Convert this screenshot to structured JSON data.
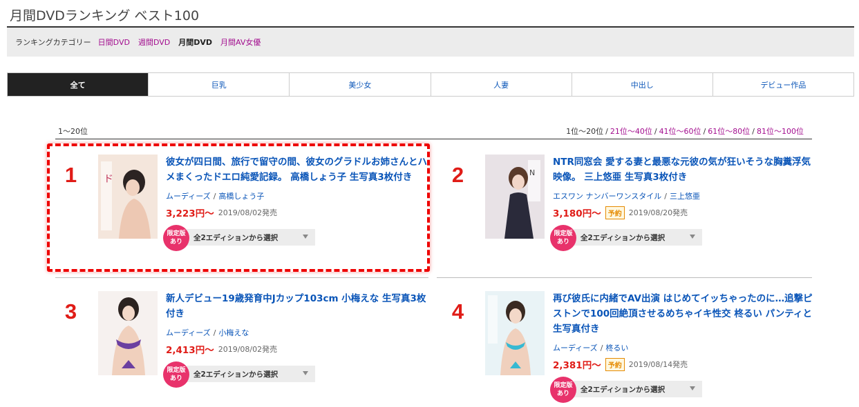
{
  "page": {
    "title": "月間DVDランキング ベスト100"
  },
  "category_bar": {
    "label": "ランキングカテゴリー",
    "links": [
      {
        "label": "日間DVD",
        "current": false
      },
      {
        "label": "週間DVD",
        "current": false
      },
      {
        "label": "月間DVD",
        "current": true
      },
      {
        "label": "月間AV女優",
        "current": false
      }
    ]
  },
  "tabs": [
    {
      "label": "全て",
      "active": true
    },
    {
      "label": "巨乳",
      "active": false
    },
    {
      "label": "美少女",
      "active": false
    },
    {
      "label": "人妻",
      "active": false
    },
    {
      "label": "中出し",
      "active": false
    },
    {
      "label": "デビュー作品",
      "active": false
    }
  ],
  "range": {
    "label": "1〜20位",
    "pager": [
      {
        "label": "1位〜20位",
        "link": false
      },
      {
        "label": "21位〜40位",
        "link": true
      },
      {
        "label": "41位〜60位",
        "link": true
      },
      {
        "label": "61位〜80位",
        "link": true
      },
      {
        "label": "81位〜100位",
        "link": true
      }
    ]
  },
  "items": [
    {
      "rank": "1",
      "title": "彼女が四日間、旅行で留守の間、彼女のグラドルお姉さんとハメまくったドエロ純愛記録。 高橋しょう子 生写真3枚付き",
      "maker": "ムーディーズ",
      "actress": "高橋しょう子",
      "price": "3,223円〜",
      "reserve": "",
      "release": "2019/08/02発売",
      "badge_line1": "限定版",
      "badge_line2": "あり",
      "edition": "全2エディションから選択"
    },
    {
      "rank": "2",
      "title": "NTR同窓会 愛する妻と最悪な元彼の気が狂いそうな胸糞浮気映像。 三上悠亜 生写真3枚付き",
      "maker": "エスワン ナンバーワンスタイル",
      "actress": "三上悠亜",
      "price": "3,180円〜",
      "reserve": "予約",
      "release": "2019/08/20発売",
      "badge_line1": "限定版",
      "badge_line2": "あり",
      "edition": "全2エディションから選択"
    },
    {
      "rank": "3",
      "title": "新人デビュー19歳発育中Jカップ103cm 小梅えな 生写真3枚付き",
      "maker": "ムーディーズ",
      "actress": "小梅えな",
      "price": "2,413円〜",
      "reserve": "",
      "release": "2019/08/02発売",
      "badge_line1": "限定版",
      "badge_line2": "あり",
      "edition": "全2エディションから選択"
    },
    {
      "rank": "4",
      "title": "再び彼氏に内緒でAV出演 はじめてイッちゃったのに…追撃ピストンで100回絶頂させるめちゃイキ性交 柊るい パンティと生写真付き",
      "maker": "ムーディーズ",
      "actress": "柊るい",
      "price": "2,381円〜",
      "reserve": "予約",
      "release": "2019/08/14発売",
      "badge_line1": "限定版",
      "badge_line2": "あり",
      "edition": "全2エディションから選択"
    }
  ],
  "colors": {
    "link": "#0a55b8",
    "category_link": "#a20c8e",
    "rank": "#e01c17",
    "price": "#e01c17",
    "badge": "#e8326b",
    "active_tab": "#222222",
    "highlight": "#ee0000"
  },
  "icons": {
    "dropdown": "chevron-down-icon",
    "thumbnail": "dvd-cover-image"
  }
}
